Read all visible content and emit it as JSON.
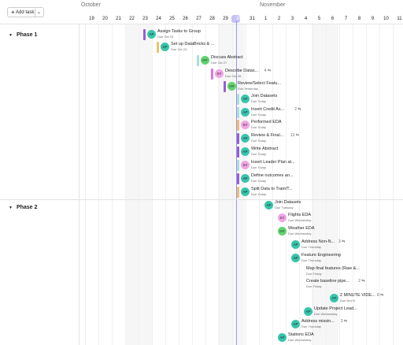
{
  "toolbar": {
    "add_task_label": "Add task",
    "plus_icon": "+",
    "dropdown_icon": "⌄"
  },
  "months": [
    {
      "label": "October"
    },
    {
      "label": "November"
    }
  ],
  "days": [
    "19",
    "20",
    "21",
    "22",
    "23",
    "24",
    "25",
    "26",
    "27",
    "28",
    "29",
    "30",
    "31",
    "1",
    "2",
    "3",
    "4",
    "5",
    "6",
    "7",
    "8",
    "9",
    "10",
    "11"
  ],
  "today": "30",
  "phases": [
    {
      "label": "Phase 1",
      "expanded": true
    },
    {
      "label": "Phase 2",
      "expanded": true
    }
  ],
  "colors": {
    "purple": "#9b5ad1",
    "teal": "#3fbfb3",
    "lightteal": "#a8dfd9",
    "pink": "#d979d9",
    "orange": "#f1bd6c",
    "av_teal": "#37c5ab",
    "av_pink": "#f2a5e5",
    "av_green": "#62d26f",
    "today_line": "#9a98ea"
  },
  "tasks": [
    {
      "title": "Assign Tasks to Group",
      "due": "Due Oct 23",
      "initials": "AP",
      "bar": "purple",
      "avatar": "av_teal",
      "subtasks": ""
    },
    {
      "title": "Set up DataBricks & ...",
      "due": "Due Oct 24",
      "initials": "AP",
      "bar": "orange",
      "avatar": "av_teal",
      "subtasks": ""
    },
    {
      "title": "Discuss Abstract",
      "due": "Due Oct 27",
      "initials": "HY",
      "bar": "lightteal",
      "avatar": "av_green",
      "subtasks": ""
    },
    {
      "title": "Describe Datas...",
      "due": "Due Oct 28",
      "initials": "SY",
      "bar": "pink",
      "avatar": "av_pink",
      "subtasks": "4 ⇆"
    },
    {
      "title": "Review/Select Featu...",
      "due": "Due Yesterday",
      "initials": "HY",
      "bar": "purple",
      "avatar": "av_green",
      "subtasks": ""
    },
    {
      "title": "Join Datasets",
      "due": "Due Today",
      "initials": "AP",
      "bar": "lightteal",
      "avatar": "av_teal",
      "subtasks": ""
    },
    {
      "title": "Insert Credit As...",
      "due": "Due Today",
      "initials": "AP",
      "bar": "lightteal",
      "avatar": "av_teal",
      "subtasks": "2 ⇆"
    },
    {
      "title": "Performed EDA",
      "due": "Due Today",
      "initials": "SY",
      "bar": "orange",
      "avatar": "av_pink",
      "subtasks": ""
    },
    {
      "title": "Review & Final...",
      "due": "Due Today",
      "initials": "AP",
      "bar": "purple",
      "avatar": "av_teal",
      "subtasks": "13 ⇆"
    },
    {
      "title": "Write Abstract",
      "due": "Due Today",
      "initials": "AP",
      "bar": "purple",
      "avatar": "av_teal",
      "subtasks": ""
    },
    {
      "title": "Insert Leader Plan at...",
      "due": "Due Today",
      "initials": "SY",
      "bar": "lightteal",
      "avatar": "av_pink",
      "subtasks": ""
    },
    {
      "title": "Define outcomes an...",
      "due": "Due Today",
      "initials": "AP",
      "bar": "purple",
      "avatar": "av_teal",
      "subtasks": ""
    },
    {
      "title": "Split Data to Train/T...",
      "due": "Due Today",
      "initials": "AP",
      "bar": "orange",
      "avatar": "av_teal",
      "subtasks": ""
    },
    {
      "title": "Join Datasets",
      "due": "Due Tuesday",
      "initials": "AP",
      "bar": "",
      "avatar": "av_teal",
      "subtasks": ""
    },
    {
      "title": "Flights EDA",
      "due": "Due Wednesday",
      "initials": "SY",
      "bar": "",
      "avatar": "av_pink",
      "subtasks": ""
    },
    {
      "title": "Weather EDA",
      "due": "Due Wednesday",
      "initials": "HY",
      "bar": "",
      "avatar": "av_green",
      "subtasks": ""
    },
    {
      "title": "Address Non-N...",
      "due": "Due Thursday",
      "initials": "AP",
      "bar": "",
      "avatar": "av_teal",
      "subtasks": "3 ⇆"
    },
    {
      "title": "Feature Engineering",
      "due": "Due Thursday",
      "initials": "AP",
      "bar": "",
      "avatar": "av_teal",
      "subtasks": ""
    },
    {
      "title": "Map final features (Raw &...",
      "due": "Due Friday",
      "initials": "",
      "bar": "",
      "avatar": "",
      "subtasks": ""
    },
    {
      "title": "Create baseline pipe...",
      "due": "Due Friday",
      "initials": "",
      "bar": "",
      "avatar": "",
      "subtasks": "2 ⇆"
    },
    {
      "title": "2 MINUTE VIDE...",
      "due": "Due Nov 6",
      "initials": "AP",
      "bar": "",
      "avatar": "av_teal",
      "subtasks": "8 ⇆"
    },
    {
      "title": "Update Project Lead...",
      "due": "Due Wednesday",
      "initials": "AP",
      "bar": "",
      "avatar": "av_teal",
      "subtasks": ""
    },
    {
      "title": "Address missin...",
      "due": "Due Thursday",
      "initials": "AP",
      "bar": "",
      "avatar": "av_teal",
      "subtasks": "3 ⇆"
    },
    {
      "title": "Stations EDA",
      "due": "Due Wednesday",
      "initials": "AP",
      "bar": "",
      "avatar": "av_teal",
      "subtasks": ""
    }
  ]
}
